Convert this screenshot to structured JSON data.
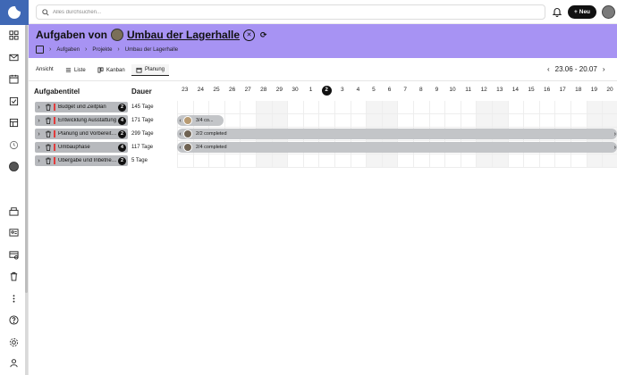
{
  "search": {
    "placeholder": "Alles durchsuchen..."
  },
  "topbar": {
    "new_label": "Neu"
  },
  "header": {
    "title_prefix": "Aufgaben von",
    "project_name": "Umbau der Lagerhalle",
    "breadcrumb": [
      "Aufgaben",
      "Projekte",
      "Umbau der Lagerhalle"
    ]
  },
  "viewbar": {
    "label": "Ansicht",
    "tabs": [
      {
        "label": "Liste"
      },
      {
        "label": "Kanban"
      },
      {
        "label": "Planung"
      }
    ],
    "date_range": "23.06 - 20.07"
  },
  "gantt": {
    "col_title": "Aufgabentitel",
    "col_duration": "Dauer",
    "days": [
      "23",
      "24",
      "25",
      "26",
      "27",
      "28",
      "29",
      "30",
      "1",
      "2",
      "3",
      "4",
      "5",
      "6",
      "7",
      "8",
      "9",
      "10",
      "11",
      "12",
      "13",
      "14",
      "15",
      "16",
      "17",
      "18",
      "19",
      "20"
    ],
    "today": "2",
    "rows": [
      {
        "title": "Budget und Zeitplan",
        "count": "2",
        "duration": "145 Tage"
      },
      {
        "title": "Entwicklung Ausstattung",
        "count": "4",
        "duration": "171 Tage",
        "bar_label": "3/4 co..."
      },
      {
        "title": "Planung und Vorbereitung",
        "count": "2",
        "duration": "299 Tage",
        "bar_label": "2/2 completed"
      },
      {
        "title": "Umbauphase",
        "count": "4",
        "duration": "117 Tage",
        "bar_label": "2/4 completed"
      },
      {
        "title": "Übergabe und Inbetriebnahme",
        "count": "2",
        "duration": "5 Tage"
      }
    ]
  }
}
